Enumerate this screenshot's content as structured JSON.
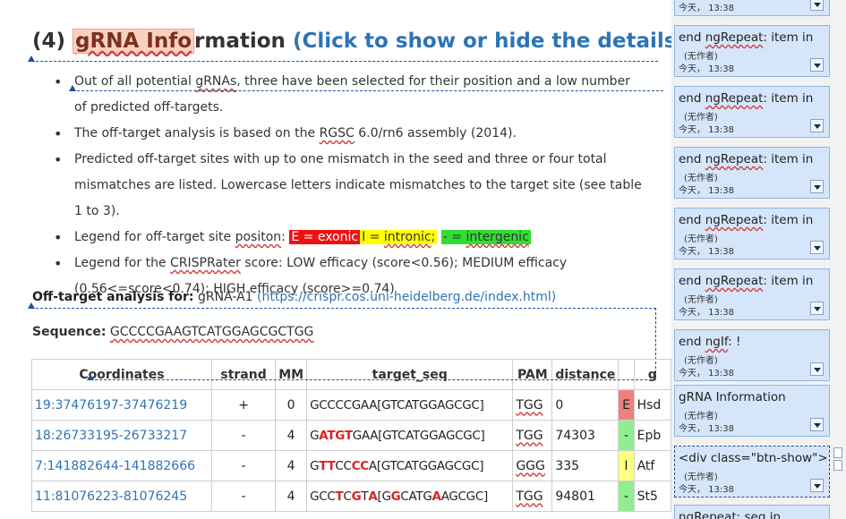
{
  "heading": {
    "prefix": "(4) ",
    "highlight": "gRNA Info",
    "rest": "rmation",
    "link": "(Click to show or hide the details.)"
  },
  "bullets": [
    {
      "pre": "Out of all potential ",
      "sq": "gRNAs",
      "post": ", three have been selected for their position and a low number of predicted off-targets."
    },
    {
      "pre": "The off-target analysis is based on the ",
      "sq": "RGSC",
      "post": " 6.0/rn6 assembly (2014)."
    },
    {
      "pre": "Predicted off-target sites with up to one mismatch in the seed and three or four total mismatches are listed. Lowercase letters indicate mismatches to the target site (see table 1 to 3).",
      "sq": "",
      "post": ""
    },
    {
      "pre": "Legend for off-target site ",
      "sq": "positon",
      "post": ": "
    },
    {
      "pre": "Legend for the ",
      "sq": "CRISPRater",
      "post": " score: LOW efficacy (score<0.56); MEDIUM efficacy (0.56<=score<0.74); HIGH efficacy (score>=0.74)"
    }
  ],
  "legend": {
    "exonic": "E = exonic",
    "intronic_pre": "I = ",
    "intronic_word": "intronic",
    "intronic_post": ";",
    "intergenic_pre": "- = ",
    "intergenic_word": "intergenic"
  },
  "offtarget": {
    "label": "Off-target analysis for:",
    "value": " gRNA-A1 ",
    "link": "(https://crispr.cos.uni-heidelberg.de/index.html)"
  },
  "sequence": {
    "label": "Sequence:",
    "value": "GCCCCGAAGTCATGGAGCGCTGG"
  },
  "table": {
    "headers": [
      "Coordinates",
      "strand",
      "MM",
      "target_seq",
      "PAM",
      "distance",
      "",
      "g"
    ],
    "rows": [
      {
        "coord": "19:37476197-37476219",
        "strand": "+",
        "mm": "0",
        "seq": [
          [
            "GCCCCGAA[GTCATGGAGCGC]",
            false
          ]
        ],
        "pam": "TGG",
        "dist": "0",
        "tag": "E",
        "gene": "Hsd"
      },
      {
        "coord": "18:26733195-26733217",
        "strand": "-",
        "mm": "4",
        "seq": [
          [
            "G",
            false
          ],
          [
            "ATGT",
            true
          ],
          [
            "GAA[GTCATGGAGCGC]",
            false
          ]
        ],
        "pam": "TGG",
        "dist": "74303",
        "tag": "-",
        "gene": "Epb"
      },
      {
        "coord": "7:141882644-141882666",
        "strand": "-",
        "mm": "4",
        "seq": [
          [
            "G",
            false
          ],
          [
            "TT",
            true
          ],
          [
            "CC",
            false
          ],
          [
            "CC",
            true
          ],
          [
            "A[GTCATGGAGCGC]",
            false
          ]
        ],
        "pam": "GGG",
        "dist": "335",
        "tag": "I",
        "gene": "Atf"
      },
      {
        "coord": "11:81076223-81076245",
        "strand": "-",
        "mm": "4",
        "seq": [
          [
            "GCC",
            false
          ],
          [
            "T",
            true
          ],
          [
            "C",
            false
          ],
          [
            "G",
            true
          ],
          [
            "T",
            false
          ],
          [
            "A",
            true
          ],
          [
            "[G",
            false
          ],
          [
            "G",
            true
          ],
          [
            "CATG",
            false
          ],
          [
            "A",
            true
          ],
          [
            "AGCGC]",
            false
          ]
        ],
        "pam": "TGG",
        "dist": "94801",
        "tag": "-",
        "gene": "St5"
      }
    ]
  },
  "comments": [
    {
      "title": "",
      "author": "(无作者)",
      "time": "今天， 13:38"
    },
    {
      "title": "end ngRepeat: item in",
      "author": "(无作者)",
      "time": "今天， 13:38"
    },
    {
      "title": "end ngRepeat: item in",
      "author": "(无作者)",
      "time": "今天， 13:38"
    },
    {
      "title": "end ngRepeat: item in",
      "author": "(无作者)",
      "time": "今天， 13:38"
    },
    {
      "title": "end ngRepeat: item in",
      "author": "(无作者)",
      "time": "今天， 13:38"
    },
    {
      "title": "end ngRepeat: item in",
      "author": "(无作者)",
      "time": "今天， 13:38"
    },
    {
      "title": "end ngIf: !",
      "author": "(无作者)",
      "time": "今天， 13:38"
    },
    {
      "title": "gRNA Information",
      "author": "(无作者)",
      "time": "今天， 13:38"
    },
    {
      "title": "<div class=\"btn-show\">",
      "author": "(无作者)",
      "time": "今天， 13:38"
    },
    {
      "title": "ngRepeat: seq in",
      "author": "",
      "time": ""
    }
  ],
  "colors": {
    "link": "#2e74b5",
    "balloon": "#d5e6fa",
    "balloon_border": "#8fb4e3",
    "mismatch": "#e02020"
  },
  "icons": [
    "comment-dropdown-icon",
    "scroll-up-icon",
    "scroll-down-icon"
  ]
}
